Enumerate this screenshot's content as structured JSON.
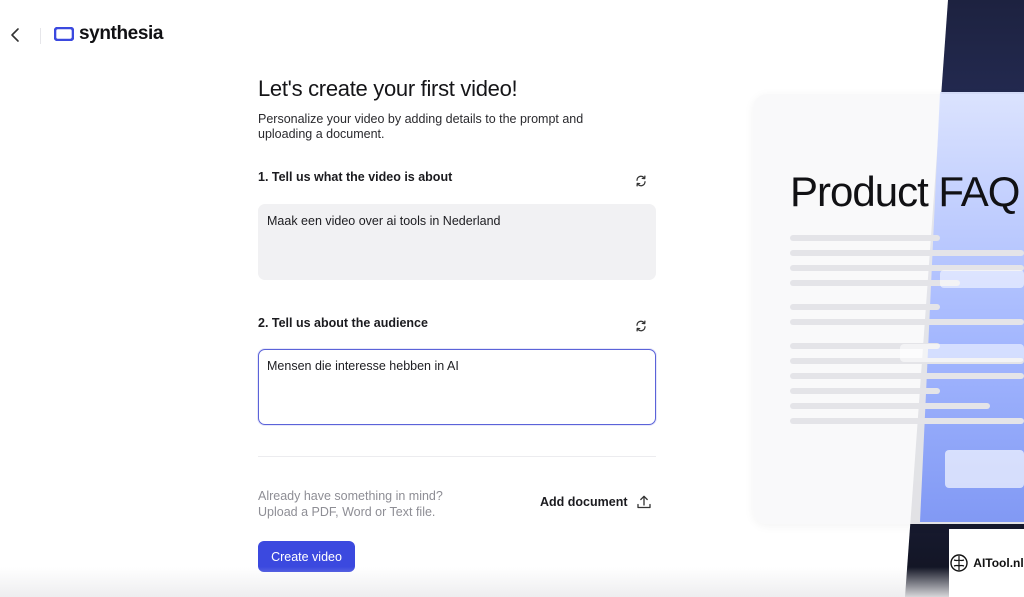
{
  "app": {
    "brand": "synthesia",
    "brand_color": "#3b49df"
  },
  "nav": {
    "back_icon": "chevron-left-icon"
  },
  "form": {
    "title": "Let's create your first video!",
    "subtitle": "Personalize your video by adding details to the prompt and uploading a document.",
    "topic": {
      "label": "1. Tell us what the video is about",
      "value": "Maak een video over ai tools in Nederland",
      "refresh_icon": "refresh-icon"
    },
    "audience": {
      "label": "2. Tell us about the audience",
      "value": "Mensen die interesse hebben in AI",
      "refresh_icon": "refresh-icon"
    },
    "upload": {
      "hint_line1": "Already have something in mind?",
      "hint_line2": "Upload a PDF, Word or Text file.",
      "add_document_label": "Add document",
      "upload_icon": "upload-icon"
    },
    "create_button_label": "Create video"
  },
  "preview": {
    "title": "Product FAQ"
  },
  "watermark": {
    "text": "AITool.nl"
  }
}
